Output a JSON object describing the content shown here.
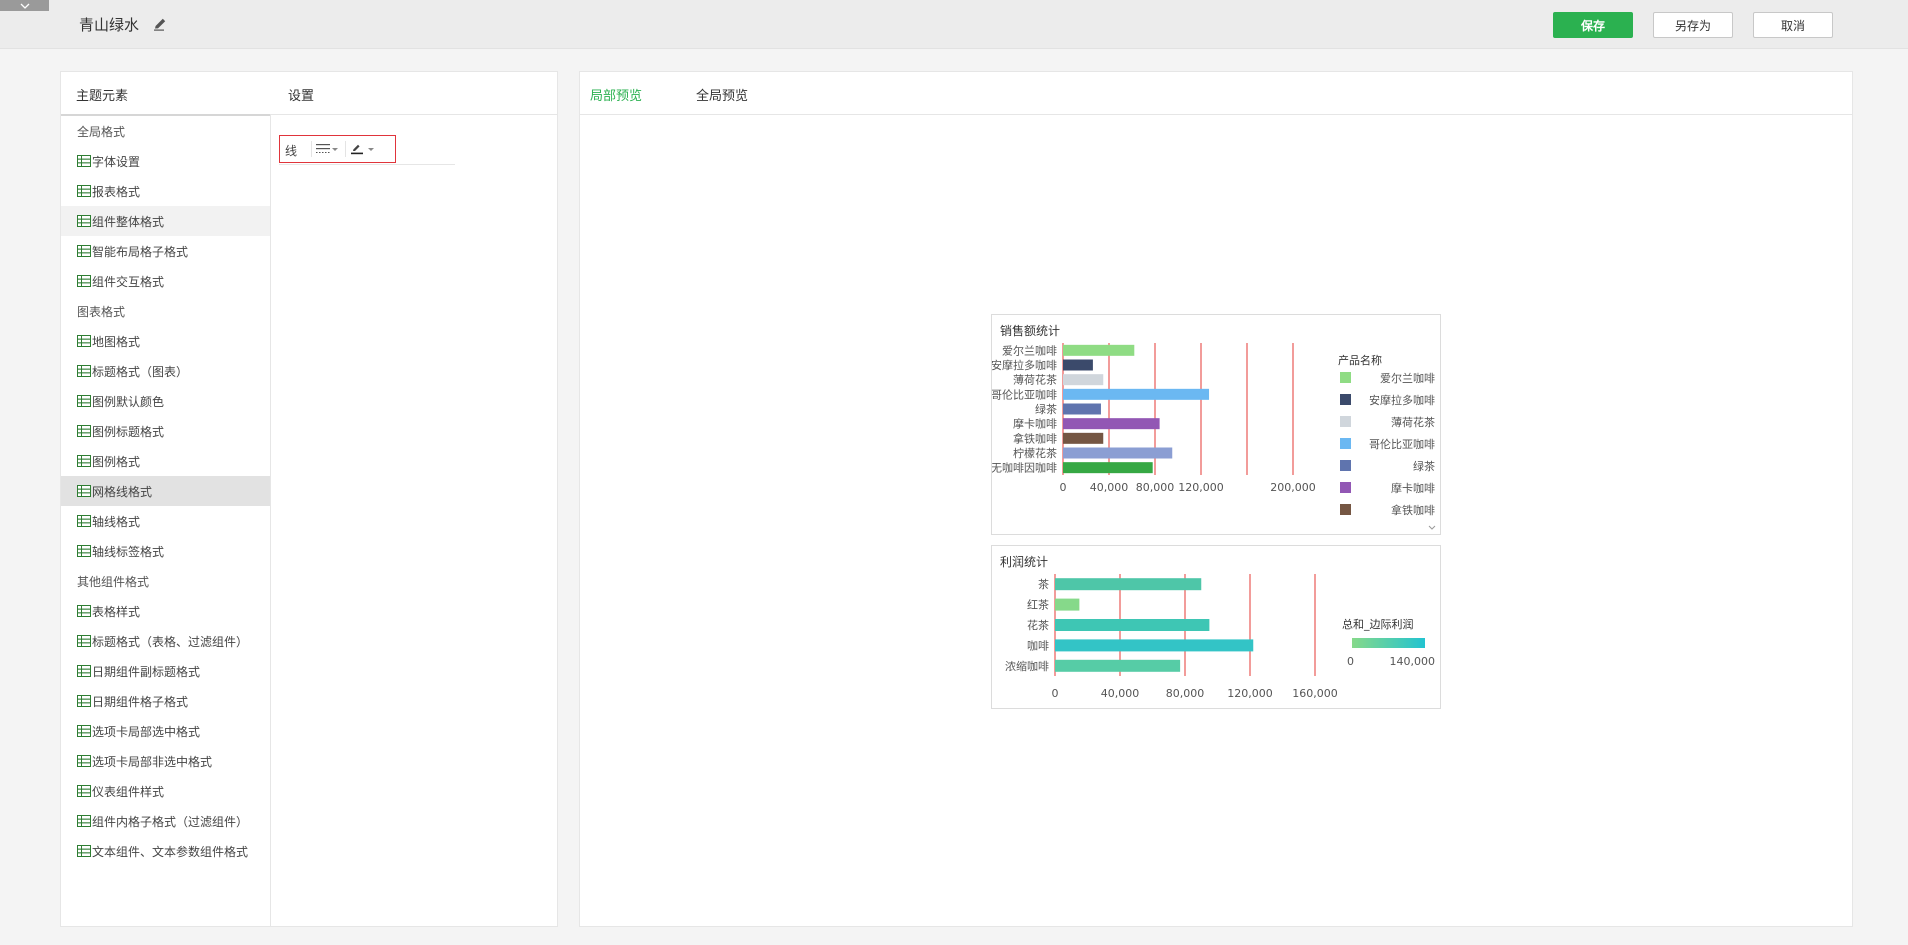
{
  "header": {
    "title": "青山绿水",
    "save_label": "保存",
    "save_as_label": "另存为",
    "cancel_label": "取消"
  },
  "left_panel": {
    "theme_tab": "主题元素",
    "settings_tab": "设置",
    "tree": [
      {
        "label": "全局格式",
        "kind": "group"
      },
      {
        "label": "字体设置",
        "kind": "child"
      },
      {
        "label": "报表格式",
        "kind": "child"
      },
      {
        "label": "组件整体格式",
        "kind": "child",
        "state": "hover"
      },
      {
        "label": "智能布局格子格式",
        "kind": "child"
      },
      {
        "label": "组件交互格式",
        "kind": "child"
      },
      {
        "label": "图表格式",
        "kind": "group"
      },
      {
        "label": "地图格式",
        "kind": "child"
      },
      {
        "label": "标题格式（图表）",
        "kind": "child"
      },
      {
        "label": "图例默认颜色",
        "kind": "child"
      },
      {
        "label": "图例标题格式",
        "kind": "child"
      },
      {
        "label": "图例格式",
        "kind": "child"
      },
      {
        "label": "网格线格式",
        "kind": "child",
        "state": "active"
      },
      {
        "label": "轴线格式",
        "kind": "child"
      },
      {
        "label": "轴线标签格式",
        "kind": "child"
      },
      {
        "label": "其他组件格式",
        "kind": "group"
      },
      {
        "label": "表格样式",
        "kind": "child"
      },
      {
        "label": "标题格式（表格、过滤组件）",
        "kind": "child"
      },
      {
        "label": "日期组件副标题格式",
        "kind": "child"
      },
      {
        "label": "日期组件格子格式",
        "kind": "child"
      },
      {
        "label": "选项卡局部选中格式",
        "kind": "child"
      },
      {
        "label": "选项卡局部非选中格式",
        "kind": "child"
      },
      {
        "label": "仪表组件样式",
        "kind": "child"
      },
      {
        "label": "组件内格子格式（过滤组件）",
        "kind": "child"
      },
      {
        "label": "文本组件、文本参数组件格式",
        "kind": "child"
      }
    ],
    "setting": {
      "label": "线",
      "line_style_icon": "line-style-icon",
      "line_color_icon": "pen-color-icon"
    }
  },
  "right_panel": {
    "tab_local": "局部预览",
    "tab_global": "全局预览"
  },
  "colors": {
    "accent": "#2bb150",
    "highlight_border": "#e0343b",
    "gridline": "#e53935"
  },
  "chart_data": [
    {
      "type": "bar",
      "orientation": "horizontal",
      "title": "销售额统计",
      "categories": [
        "爱尔兰咖啡",
        "安摩拉多咖啡",
        "薄荷花茶",
        "哥伦比亚咖啡",
        "绿茶",
        "摩卡咖啡",
        "拿铁咖啡",
        "柠檬花茶",
        "无咖啡因咖啡"
      ],
      "values": [
        62000,
        26000,
        35000,
        127000,
        33000,
        84000,
        35000,
        95000,
        78000
      ],
      "colors": [
        "#8fdc84",
        "#3b4a6b",
        "#d0d6dc",
        "#6bb8f2",
        "#5f74ae",
        "#9257b4",
        "#755643",
        "#8b9ed3",
        "#36a844"
      ],
      "xtick_labels": [
        "0",
        "40,000",
        "80,000",
        "120,000",
        "200,000"
      ],
      "xtick_values": [
        0,
        40000,
        80000,
        120000,
        200000
      ],
      "gridlines": [
        0,
        40000,
        80000,
        120000,
        160000,
        200000
      ],
      "xlim": [
        0,
        200000
      ],
      "legend": {
        "title": "产品名称",
        "position": "right",
        "entries": [
          "爱尔兰咖啡",
          "安摩拉多咖啡",
          "薄荷花茶",
          "哥伦比亚咖啡",
          "绿茶",
          "摩卡咖啡",
          "拿铁咖啡"
        ]
      }
    },
    {
      "type": "bar",
      "orientation": "horizontal",
      "title": "利润统计",
      "categories": [
        "茶",
        "红茶",
        "花茶",
        "咖啡",
        "浓缩咖啡"
      ],
      "values": [
        90000,
        15000,
        95000,
        122000,
        77000
      ],
      "colors": [
        "#4ec6a8",
        "#86d98a",
        "#3ec6b4",
        "#33c4c6",
        "#56cca6"
      ],
      "xtick_labels": [
        "0",
        "40,000",
        "80,000",
        "120,000",
        "160,000"
      ],
      "xtick_values": [
        0,
        40000,
        80000,
        120000,
        160000
      ],
      "gridlines": [
        0,
        40000,
        80000,
        120000,
        160000
      ],
      "xlim": [
        0,
        160000
      ],
      "legend": {
        "title": "总和_边际利润",
        "position": "right",
        "gradient": [
          "#86d98a",
          "#22c3d0"
        ],
        "min_label": "0",
        "max_label": "140,000"
      }
    }
  ]
}
